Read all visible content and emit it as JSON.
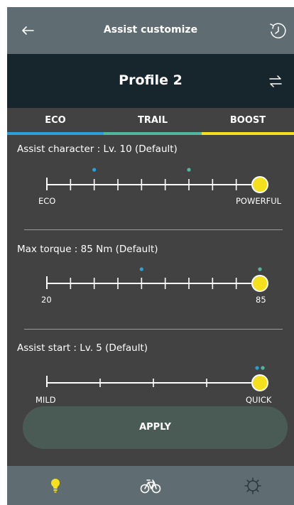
{
  "header": {
    "title": "Assist customize",
    "back_icon": "back-arrow-icon",
    "history_icon": "history-reset-icon"
  },
  "profile": {
    "name": "Profile 2",
    "swap_icon": "swap-arrows-icon"
  },
  "tabs": [
    {
      "label": "ECO",
      "color": "#29a0d8"
    },
    {
      "label": "TRAIL",
      "color": "#4fb89f"
    },
    {
      "label": "BOOST",
      "color": "#f4e01d"
    }
  ],
  "sections": [
    {
      "label": "Assist character : Lv. 10 (Default)",
      "min_label": "ECO",
      "max_label": "POWERFUL",
      "ticks": 10,
      "value_index": 9,
      "eco_marker_index": 2,
      "trail_marker_index": 6
    },
    {
      "label": "Max torque : 85 Nm (Default)",
      "min_label": "20",
      "max_label": "85",
      "ticks": 10,
      "value_index": 9,
      "eco_marker_index": 4,
      "trail_marker_index": 9
    },
    {
      "label": "Assist start : Lv. 5 (Default)",
      "min_label": "MILD",
      "max_label": "QUICK",
      "ticks": 5,
      "value_index": 4,
      "eco_marker_index": 4,
      "trail_marker_index": 4
    }
  ],
  "apply_label": "APPLY",
  "colors": {
    "eco": "#29a0d8",
    "trail": "#4fb89f",
    "boost": "#f4e01d",
    "knob": "#f4e01d"
  },
  "bottom_nav": [
    {
      "icon": "lightbulb-icon",
      "active": true
    },
    {
      "icon": "bicycle-icon",
      "active": false
    },
    {
      "icon": "settings-gear-icon",
      "active": false
    }
  ]
}
